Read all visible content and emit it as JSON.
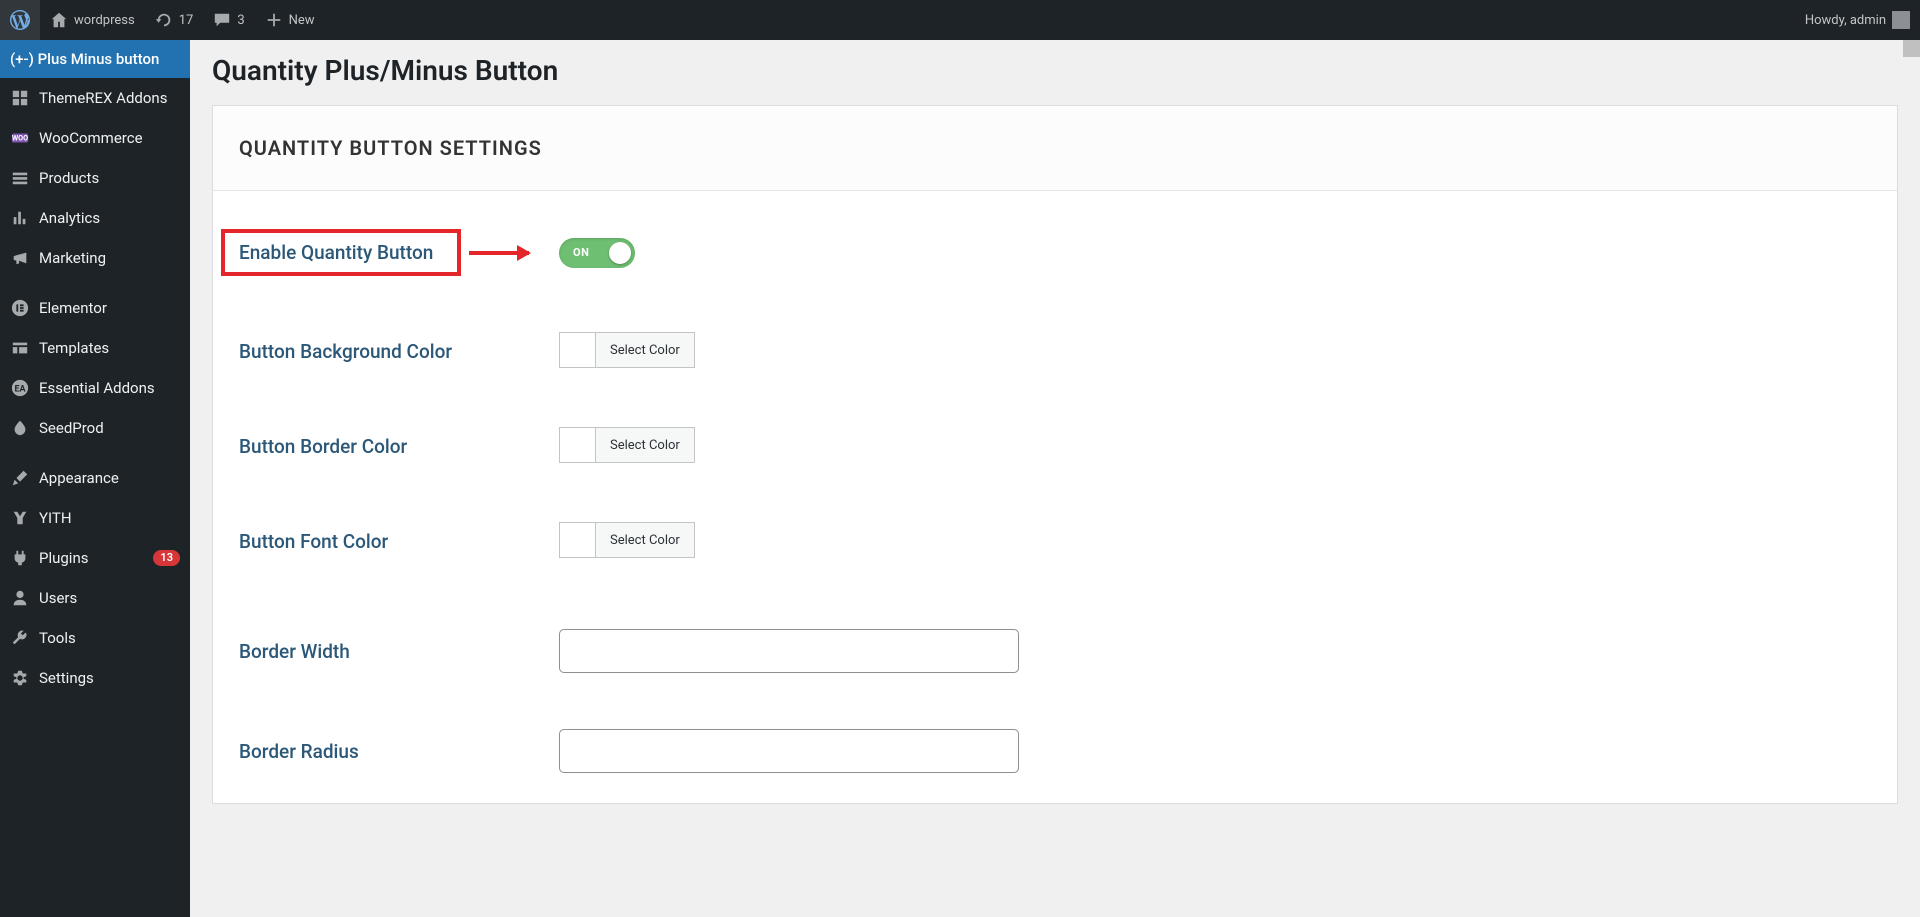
{
  "adminbar": {
    "site_name": "wordpress",
    "updates": "17",
    "comments": "3",
    "new": "New",
    "howdy": "Howdy, admin"
  },
  "sidebar": {
    "items": [
      {
        "label": "(+-) Plus Minus button",
        "current": true
      },
      {
        "label": "ThemeREX Addons"
      },
      {
        "label": "WooCommerce"
      },
      {
        "label": "Products"
      },
      {
        "label": "Analytics"
      },
      {
        "label": "Marketing"
      },
      {
        "label": "Elementor"
      },
      {
        "label": "Templates"
      },
      {
        "label": "Essential Addons"
      },
      {
        "label": "SeedProd"
      },
      {
        "label": "Appearance"
      },
      {
        "label": "YITH"
      },
      {
        "label": "Plugins",
        "badge": "13"
      },
      {
        "label": "Users"
      },
      {
        "label": "Tools"
      },
      {
        "label": "Settings"
      }
    ]
  },
  "page": {
    "title": "Quantity Plus/Minus Button",
    "section_heading": "QUANTITY BUTTON SETTINGS",
    "fields": {
      "enable": {
        "label": "Enable Quantity Button",
        "toggle": "ON"
      },
      "bg_color": {
        "label": "Button Background Color",
        "button": "Select Color"
      },
      "border_color": {
        "label": "Button Border Color",
        "button": "Select Color"
      },
      "font_color": {
        "label": "Button Font Color",
        "button": "Select Color"
      },
      "border_width": {
        "label": "Border Width",
        "value": ""
      },
      "border_radius": {
        "label": "Border Radius",
        "value": ""
      }
    }
  },
  "annotation": {
    "highlight_color": "#e4252a",
    "toggle_on_color": "#6fbf73"
  }
}
